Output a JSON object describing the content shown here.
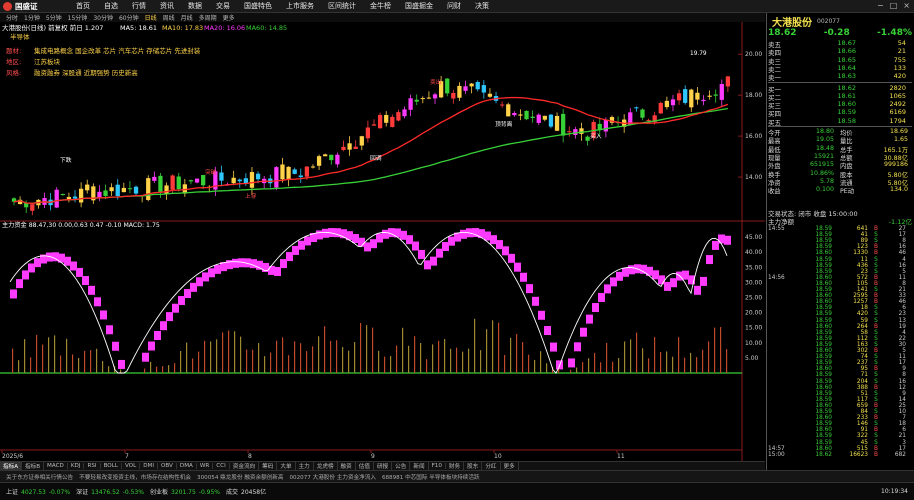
{
  "app": {
    "logo": "国盛证",
    "menus": [
      "首页",
      "自选",
      "行情",
      "资讯",
      "数据",
      "交易",
      "国盛特色",
      "上市服务",
      "区间统计",
      "金牛榜",
      "国盛掘金",
      "问财",
      "决策"
    ],
    "periods": [
      "分时",
      "1分钟",
      "5分钟",
      "15分钟",
      "30分钟",
      "60分钟",
      "日线",
      "周线",
      "月线",
      "多周期",
      "更多"
    ],
    "active_period": "日线"
  },
  "chart": {
    "title": "大港股份(日线) 前复权 前日 1.207",
    "ma_labels": [
      {
        "text": "MA5: 18.61",
        "color": "#ffffff"
      },
      {
        "text": "MA10: 17.83",
        "color": "#ffd24a"
      },
      {
        "text": "MA20: 16.06",
        "color": "#ff3bff"
      },
      {
        "text": "MA60: 14.85",
        "color": "#37d037"
      }
    ],
    "annotations": [
      {
        "label": "题材:",
        "text": "集成电路概念 国企改革 芯片 汽车芯片 存储芯片 先进封装",
        "color": "#ff4d4d"
      },
      {
        "label": "地区:",
        "text": "江苏板块",
        "color": "#ff4d4d"
      },
      {
        "label": "风格:",
        "text": "融资融券 深股通 近期强势 历史新高",
        "color": "#ff4d4d"
      }
    ],
    "tag_first": "半导体",
    "price_ticks": [
      "20",
      "18",
      "16",
      "14"
    ],
    "indicator_label": "主力资金 88.47,30 0.00,0.63 0.47 -0.10 MACD: 1.75",
    "indicator_ticks": [
      "45.00",
      "40.00",
      "35.00",
      "30.00",
      "25.00",
      "20.00",
      "15.00",
      "10.00",
      "5.00"
    ],
    "date_labels": [
      "2025/6",
      "7",
      "8",
      "9",
      "10",
      "11"
    ],
    "high_label": "19.79",
    "chart_callouts": [
      "下跌",
      "上穿",
      "顶背离",
      "突破",
      "买入",
      "卖出",
      "回调"
    ]
  },
  "chart_data": {
    "type": "candlestick",
    "x": [
      "2025-06",
      "2025-07",
      "2025-08",
      "2025-09",
      "2025-10",
      "2025-11"
    ],
    "close_trend": [
      12.8,
      13.6,
      14.2,
      18.5,
      16.1,
      18.62
    ],
    "ylim": [
      12,
      20.5
    ],
    "indicator_ylim": [
      0,
      48
    ]
  },
  "bottom_tabs": [
    "指标A",
    "指标B",
    "MACD",
    "KDJ",
    "RSI",
    "BOLL",
    "VOL",
    "DMI",
    "OBV",
    "DMA",
    "WR",
    "CCI",
    "资金流向",
    "筹码",
    "大单",
    "主力",
    "龙虎榜",
    "融资",
    "估值",
    "研报",
    "公告",
    "新闻",
    "F10",
    "财务",
    "股东",
    "分红",
    "更多"
  ],
  "news": [
    "关于东方证券相关行情公告",
    "不要轻易改变投资主线，市场存在结构性机会",
    "300054 鼎龙股份 融资余额创新高",
    "002077 大港股份 主力资金净流入",
    "688981 中芯国际 半导体板块持续活跃"
  ],
  "indices": [
    {
      "name": "上证",
      "value": "4027.53",
      "chg": "-0.07%",
      "color": "#37d037"
    },
    {
      "name": "深证",
      "value": "13476.52",
      "chg": "-0.53%",
      "color": "#37d037"
    },
    {
      "name": "创业板",
      "value": "3201.75",
      "chg": "-0.95%",
      "color": "#37d037"
    },
    {
      "name": "成交",
      "value": "20458亿",
      "chg": "",
      "color": "#ddd"
    }
  ],
  "clock": "10:19:34",
  "quote": {
    "name": "大港股份",
    "code": "002077",
    "price": "18.62",
    "change": "-0.28",
    "pct": "-1.48%",
    "asks": [
      {
        "label": "卖五",
        "price": "18.67",
        "vol": "54"
      },
      {
        "label": "卖四",
        "price": "18.66",
        "vol": "21"
      },
      {
        "label": "卖三",
        "price": "18.65",
        "vol": "755"
      },
      {
        "label": "卖二",
        "price": "18.64",
        "vol": "133"
      },
      {
        "label": "卖一",
        "price": "18.63",
        "vol": "420"
      }
    ],
    "bids": [
      {
        "label": "买一",
        "price": "18.62",
        "vol": "2820"
      },
      {
        "label": "买二",
        "price": "18.61",
        "vol": "1065"
      },
      {
        "label": "买三",
        "price": "18.60",
        "vol": "2492"
      },
      {
        "label": "买四",
        "price": "18.59",
        "vol": "6169"
      },
      {
        "label": "买五",
        "price": "18.58",
        "vol": "1794"
      }
    ],
    "stats": [
      {
        "a": "今开",
        "b": "18.80",
        "c": "均价",
        "d": "18.69"
      },
      {
        "a": "最高",
        "b": "19.05",
        "c": "量比",
        "d": "1.65"
      },
      {
        "a": "最低",
        "b": "18.48",
        "c": "总手",
        "d": "165.1万"
      },
      {
        "a": "现量",
        "b": "15921",
        "c": "总额",
        "d": "30.88亿"
      },
      {
        "a": "外盘",
        "b": "651915",
        "c": "内盘",
        "d": "999186"
      },
      {
        "a": "换手",
        "b": "10.86%",
        "c": "股本",
        "d": "5.80亿"
      },
      {
        "a": "净资",
        "b": "5.78",
        "c": "流通",
        "d": "5.80亿"
      },
      {
        "a": "收益",
        "b": "0.100",
        "c": "PE动",
        "d": "134.0"
      }
    ],
    "status_label": "交易状态: 闭市 收盘 15:00:00",
    "fund_label": "主力净额",
    "fund_value": "-1.12亿"
  },
  "ticks": [
    {
      "t": "14:55",
      "p": "18.59",
      "v": "641",
      "s": "B",
      "n": "27"
    },
    {
      "t": "",
      "p": "18.59",
      "v": "41",
      "s": "S",
      "n": "17"
    },
    {
      "t": "",
      "p": "18.59",
      "v": "89",
      "s": "S",
      "n": "8"
    },
    {
      "t": "",
      "p": "18.59",
      "v": "123",
      "s": "B",
      "n": "16"
    },
    {
      "t": "",
      "p": "18.60",
      "v": "1330",
      "s": "B",
      "n": "46"
    },
    {
      "t": "",
      "p": "18.59",
      "v": "11",
      "s": "S",
      "n": "4"
    },
    {
      "t": "",
      "p": "18.59",
      "v": "436",
      "s": "S",
      "n": "16"
    },
    {
      "t": "",
      "p": "18.59",
      "v": "23",
      "s": "S",
      "n": "5"
    },
    {
      "t": "14:56",
      "p": "18.60",
      "v": "572",
      "s": "B",
      "n": "11"
    },
    {
      "t": "",
      "p": "18.60",
      "v": "105",
      "s": "B",
      "n": "8"
    },
    {
      "t": "",
      "p": "18.59",
      "v": "141",
      "s": "S",
      "n": "21"
    },
    {
      "t": "",
      "p": "18.60",
      "v": "2595",
      "s": "B",
      "n": "33"
    },
    {
      "t": "",
      "p": "18.60",
      "v": "1257",
      "s": "B",
      "n": "46"
    },
    {
      "t": "",
      "p": "18.59",
      "v": "18",
      "s": "S",
      "n": "6"
    },
    {
      "t": "",
      "p": "18.59",
      "v": "420",
      "s": "S",
      "n": "23"
    },
    {
      "t": "",
      "p": "18.59",
      "v": "59",
      "s": "S",
      "n": "13"
    },
    {
      "t": "",
      "p": "18.60",
      "v": "264",
      "s": "B",
      "n": "19"
    },
    {
      "t": "",
      "p": "18.59",
      "v": "58",
      "s": "S",
      "n": "4"
    },
    {
      "t": "",
      "p": "18.59",
      "v": "112",
      "s": "S",
      "n": "22"
    },
    {
      "t": "",
      "p": "18.59",
      "v": "163",
      "s": "S",
      "n": "30"
    },
    {
      "t": "",
      "p": "18.60",
      "v": "302",
      "s": "B",
      "n": "5"
    },
    {
      "t": "",
      "p": "18.59",
      "v": "74",
      "s": "S",
      "n": "11"
    },
    {
      "t": "",
      "p": "18.59",
      "v": "237",
      "s": "S",
      "n": "17"
    },
    {
      "t": "",
      "p": "18.60",
      "v": "95",
      "s": "B",
      "n": "9"
    },
    {
      "t": "",
      "p": "18.59",
      "v": "71",
      "s": "S",
      "n": "8"
    },
    {
      "t": "",
      "p": "18.59",
      "v": "204",
      "s": "S",
      "n": "16"
    },
    {
      "t": "",
      "p": "18.60",
      "v": "388",
      "s": "B",
      "n": "12"
    },
    {
      "t": "",
      "p": "18.59",
      "v": "51",
      "s": "S",
      "n": "9"
    },
    {
      "t": "",
      "p": "18.59",
      "v": "117",
      "s": "S",
      "n": "14"
    },
    {
      "t": "",
      "p": "18.60",
      "v": "659",
      "s": "B",
      "n": "25"
    },
    {
      "t": "",
      "p": "18.59",
      "v": "84",
      "s": "S",
      "n": "10"
    },
    {
      "t": "",
      "p": "18.60",
      "v": "233",
      "s": "B",
      "n": "7"
    },
    {
      "t": "",
      "p": "18.59",
      "v": "146",
      "s": "S",
      "n": "18"
    },
    {
      "t": "",
      "p": "18.60",
      "v": "91",
      "s": "B",
      "n": "6"
    },
    {
      "t": "",
      "p": "18.59",
      "v": "322",
      "s": "S",
      "n": "21"
    },
    {
      "t": "",
      "p": "18.59",
      "v": "45",
      "s": "S",
      "n": "3"
    },
    {
      "t": "14:57",
      "p": "18.60",
      "v": "515",
      "s": "B",
      "n": "17"
    },
    {
      "t": "15:00",
      "p": "18.62",
      "v": "16623",
      "s": "B",
      "n": "682"
    }
  ]
}
